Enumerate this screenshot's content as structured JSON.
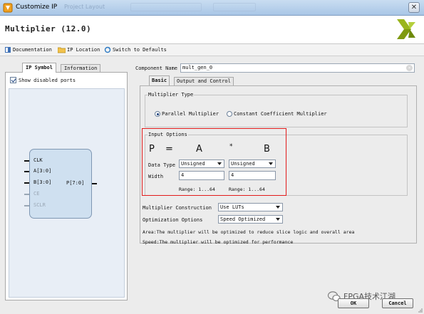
{
  "window": {
    "title": "Customize IP",
    "ghost_tab": "Project Layout"
  },
  "header": {
    "ip_name": "Multiplier (12.0)"
  },
  "toolbar": {
    "documentation": "Documentation",
    "ip_location": "IP Location",
    "switch_defaults": "Switch to Defaults"
  },
  "left": {
    "tabs": [
      "IP Symbol",
      "Information"
    ],
    "show_disabled_ports": "Show disabled ports",
    "pins_left": [
      "CLK",
      "A[3:0]",
      "B[3:0]",
      "CE",
      "SCLR"
    ],
    "pins_right": [
      "P[7:0]"
    ]
  },
  "right": {
    "component_name_label": "Component Name",
    "component_name_value": "mult_gen_0",
    "tabs": [
      "Basic",
      "Output and Control"
    ],
    "multiplier_type": {
      "legend": "Multiplier Type",
      "options": [
        "Parallel Multiplier",
        "Constant Coefficient Multiplier"
      ],
      "selected": "Parallel Multiplier"
    },
    "input_options": {
      "legend": "Input Options",
      "eq_p": "P",
      "eq_equals": "=",
      "eq_a": "A",
      "eq_times": "*",
      "eq_b": "B",
      "data_type_label": "Data Type",
      "data_type_a": "Unsigned",
      "data_type_b": "Unsigned",
      "width_label": "Width",
      "width_a": "4",
      "width_b": "4",
      "range_a": "Range: 1...64",
      "range_b": "Range: 1...64"
    },
    "multiplier_construction_label": "Multiplier Construction",
    "multiplier_construction_value": "Use LUTs",
    "optimization_label": "Optimization Options",
    "optimization_value": "Speed Optimized",
    "notes": [
      "Area:The multiplier will be optimized to reduce slice logic and overall area",
      "Speed:The multiplier will be optimized for performance"
    ]
  },
  "buttons": {
    "ok": "OK",
    "cancel": "Cancel"
  },
  "watermark": "FPGA技术江湖",
  "colors": {
    "highlight_box": "#e21b1b",
    "symbol_fill": "#cfe0f0",
    "titlebar": "#b9d1ec"
  }
}
